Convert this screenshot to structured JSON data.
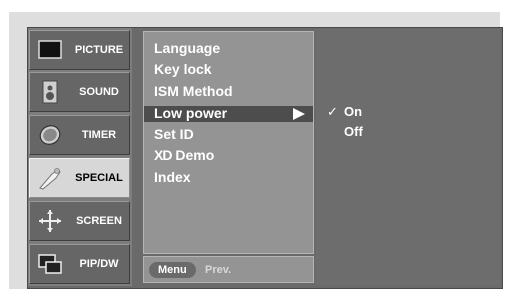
{
  "sidebar": {
    "items": [
      {
        "label": "PICTURE",
        "icon": "picture-icon"
      },
      {
        "label": "SOUND",
        "icon": "speaker-icon"
      },
      {
        "label": "TIMER",
        "icon": "timer-icon"
      },
      {
        "label": "SPECIAL",
        "icon": "special-icon",
        "active": true
      },
      {
        "label": "SCREEN",
        "icon": "screen-move-icon"
      },
      {
        "label": "PIP/DW",
        "icon": "pip-icon"
      }
    ]
  },
  "menu": {
    "items": [
      "Language",
      "Key lock",
      "ISM Method",
      "Low power",
      "Set ID",
      "Demo",
      "Index"
    ],
    "selected_index": 3,
    "xd_logo": "XD"
  },
  "options": {
    "items": [
      "On",
      "Off"
    ],
    "checked": "On",
    "check_mark": "✓"
  },
  "footer": {
    "menu_label": "Menu",
    "prev_label": "Prev."
  },
  "colors": {
    "osd_background": "#6a6a6a",
    "panel": "#949494",
    "highlight": "#4d4d4d",
    "active_tab": "#d7d7d7"
  }
}
